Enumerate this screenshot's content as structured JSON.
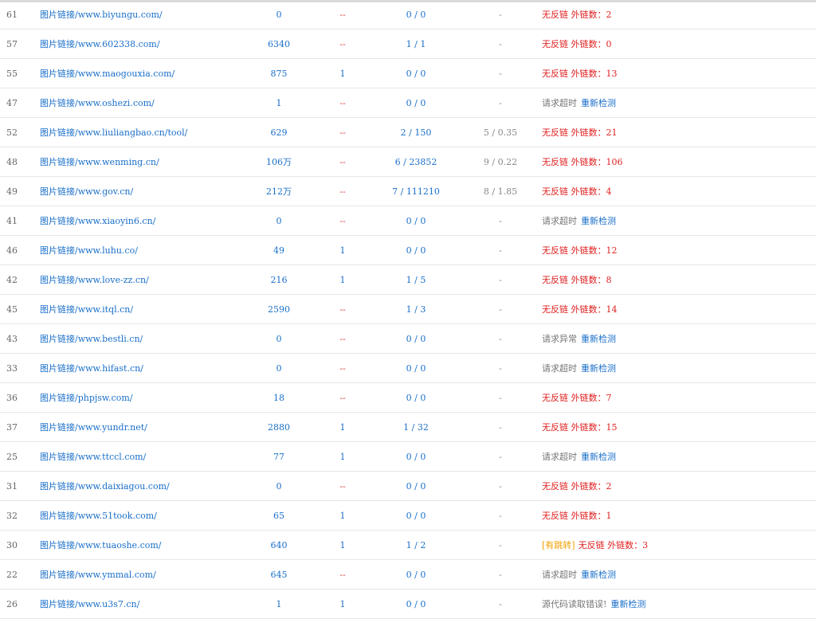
{
  "rows": [
    {
      "id": "61",
      "link": "图片链接/www.biyungu.com/",
      "pr": "0",
      "br": "--",
      "ext": "0 / 0",
      "rank": "-",
      "status_type": "nolink",
      "status": "无反链 外链数：2"
    },
    {
      "id": "57",
      "link": "图片链接/www.602338.com/",
      "pr": "6340",
      "br": "--",
      "ext": "1 / 1",
      "rank": "-",
      "status_type": "nolink",
      "status": "无反链 外链数：0"
    },
    {
      "id": "55",
      "link": "图片链接/www.maogouxia.com/",
      "pr": "875",
      "br": "1",
      "ext": "0 / 0",
      "rank": "-",
      "status_type": "nolink",
      "status": "无反链 外链数：13"
    },
    {
      "id": "47",
      "link": "图片链接/www.oshezi.com/",
      "pr": "1",
      "br": "--",
      "ext": "0 / 0",
      "rank": "-",
      "status_type": "timeout",
      "status": "请求超时",
      "recheck": "重新检测"
    },
    {
      "id": "52",
      "link": "图片链接/www.liuliangbao.cn/tool/",
      "pr": "629",
      "br": "--",
      "ext": "2 / 150",
      "rank": "5 / 0.35",
      "status_type": "nolink",
      "status": "无反链 外链数：21"
    },
    {
      "id": "48",
      "link": "图片链接/www.wenming.cn/",
      "pr": "106万",
      "br": "--",
      "ext": "6 / 23852",
      "rank": "9 / 0.22",
      "status_type": "nolink",
      "status": "无反链 外链数：106"
    },
    {
      "id": "49",
      "link": "图片链接/www.gov.cn/",
      "pr": "212万",
      "br": "--",
      "ext": "7 / 111210",
      "rank": "8 / 1.85",
      "status_type": "nolink",
      "status": "无反链 外链数：4"
    },
    {
      "id": "41",
      "link": "图片链接/www.xiaoyin6.cn/",
      "pr": "0",
      "br": "--",
      "ext": "0 / 0",
      "rank": "-",
      "status_type": "timeout",
      "status": "请求超时",
      "recheck": "重新检测"
    },
    {
      "id": "46",
      "link": "图片链接/www.luhu.co/",
      "pr": "49",
      "br": "1",
      "ext": "0 / 0",
      "rank": "-",
      "status_type": "nolink",
      "status": "无反链 外链数：12"
    },
    {
      "id": "42",
      "link": "图片链接/www.love-zz.cn/",
      "pr": "216",
      "br": "1",
      "ext": "1 / 5",
      "rank": "-",
      "status_type": "nolink",
      "status": "无反链 外链数：8"
    },
    {
      "id": "45",
      "link": "图片链接/www.itql.cn/",
      "pr": "2590",
      "br": "--",
      "ext": "1 / 3",
      "rank": "-",
      "status_type": "nolink",
      "status": "无反链 外链数：14"
    },
    {
      "id": "43",
      "link": "图片链接/www.bestli.cn/",
      "pr": "0",
      "br": "--",
      "ext": "0 / 0",
      "rank": "-",
      "status_type": "timeout",
      "status": "请求异常",
      "recheck": "重新检测"
    },
    {
      "id": "33",
      "link": "图片链接/www.hifast.cn/",
      "pr": "0",
      "br": "--",
      "ext": "0 / 0",
      "rank": "-",
      "status_type": "timeout",
      "status": "请求超时",
      "recheck": "重新检测"
    },
    {
      "id": "36",
      "link": "图片链接/phpjsw.com/",
      "pr": "18",
      "br": "--",
      "ext": "0 / 0",
      "rank": "-",
      "status_type": "nolink",
      "status": "无反链 外链数：7"
    },
    {
      "id": "37",
      "link": "图片链接/www.yundr.net/",
      "pr": "2880",
      "br": "1",
      "ext": "1 / 32",
      "rank": "-",
      "status_type": "nolink",
      "status": "无反链 外链数：15"
    },
    {
      "id": "25",
      "link": "图片链接/www.ttccl.com/",
      "pr": "77",
      "br": "1",
      "ext": "0 / 0",
      "rank": "-",
      "status_type": "timeout",
      "status": "请求超时",
      "recheck": "重新检测"
    },
    {
      "id": "31",
      "link": "图片链接/www.daixiagou.com/",
      "pr": "0",
      "br": "--",
      "ext": "0 / 0",
      "rank": "-",
      "status_type": "nolink",
      "status": "无反链 外链数：2"
    },
    {
      "id": "32",
      "link": "图片链接/www.51took.com/",
      "pr": "65",
      "br": "1",
      "ext": "0 / 0",
      "rank": "-",
      "status_type": "nolink",
      "status": "无反链 外链数：1"
    },
    {
      "id": "30",
      "link": "图片链接/www.tuaoshe.com/",
      "pr": "640",
      "br": "1",
      "ext": "1 / 2",
      "rank": "-",
      "status_type": "redirect",
      "tag": "[有跳转]",
      "status": "无反链 外链数：3"
    },
    {
      "id": "22",
      "link": "图片链接/www.ymmal.com/",
      "pr": "645",
      "br": "--",
      "ext": "0 / 0",
      "rank": "-",
      "status_type": "timeout",
      "status": "请求超时",
      "recheck": "重新检测"
    },
    {
      "id": "26",
      "link": "图片链接/www.u3s7.cn/",
      "pr": "1",
      "br": "1",
      "ext": "0 / 0",
      "rank": "-",
      "status_type": "timeout",
      "status": "源代码读取错误!",
      "recheck": "重新检测"
    }
  ]
}
